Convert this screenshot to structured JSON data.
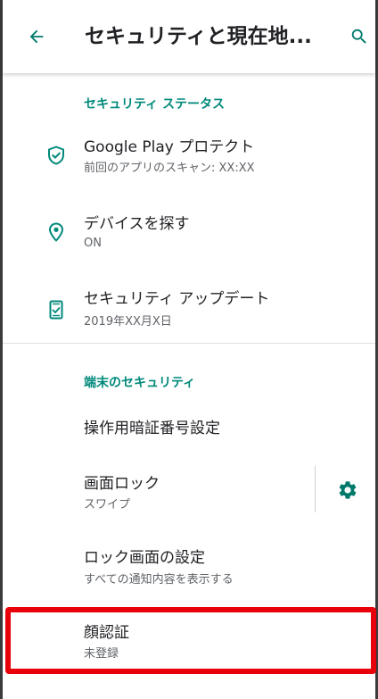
{
  "colors": {
    "accent": "#00897b",
    "highlight": "#e8000a"
  },
  "toolbar": {
    "back_icon": "arrow-back-icon",
    "title": "セキュリティと現在地...",
    "search_icon": "search-icon"
  },
  "security_status": {
    "header": "セキュリティ ステータス",
    "items": [
      {
        "icon": "shield-check-icon",
        "label": "Google Play プロテクト",
        "summary": "前回のアプリのスキャン: XX:XX"
      },
      {
        "icon": "location-pin-icon",
        "label": "デバイスを探す",
        "summary": "ON"
      },
      {
        "icon": "phone-update-icon",
        "label": "セキュリティ アップデート",
        "summary": "2019年XX月X日"
      }
    ]
  },
  "device_security": {
    "header": "端末のセキュリティ",
    "items": [
      {
        "label": "操作用暗証番号設定"
      },
      {
        "label": "画面ロック",
        "summary": "スワイプ",
        "action_icon": "gear-icon"
      },
      {
        "label": "ロック画面の設定",
        "summary": "すべての通知内容を表示する"
      },
      {
        "label": "顔認証",
        "summary": "未登録",
        "highlighted": true
      }
    ]
  }
}
